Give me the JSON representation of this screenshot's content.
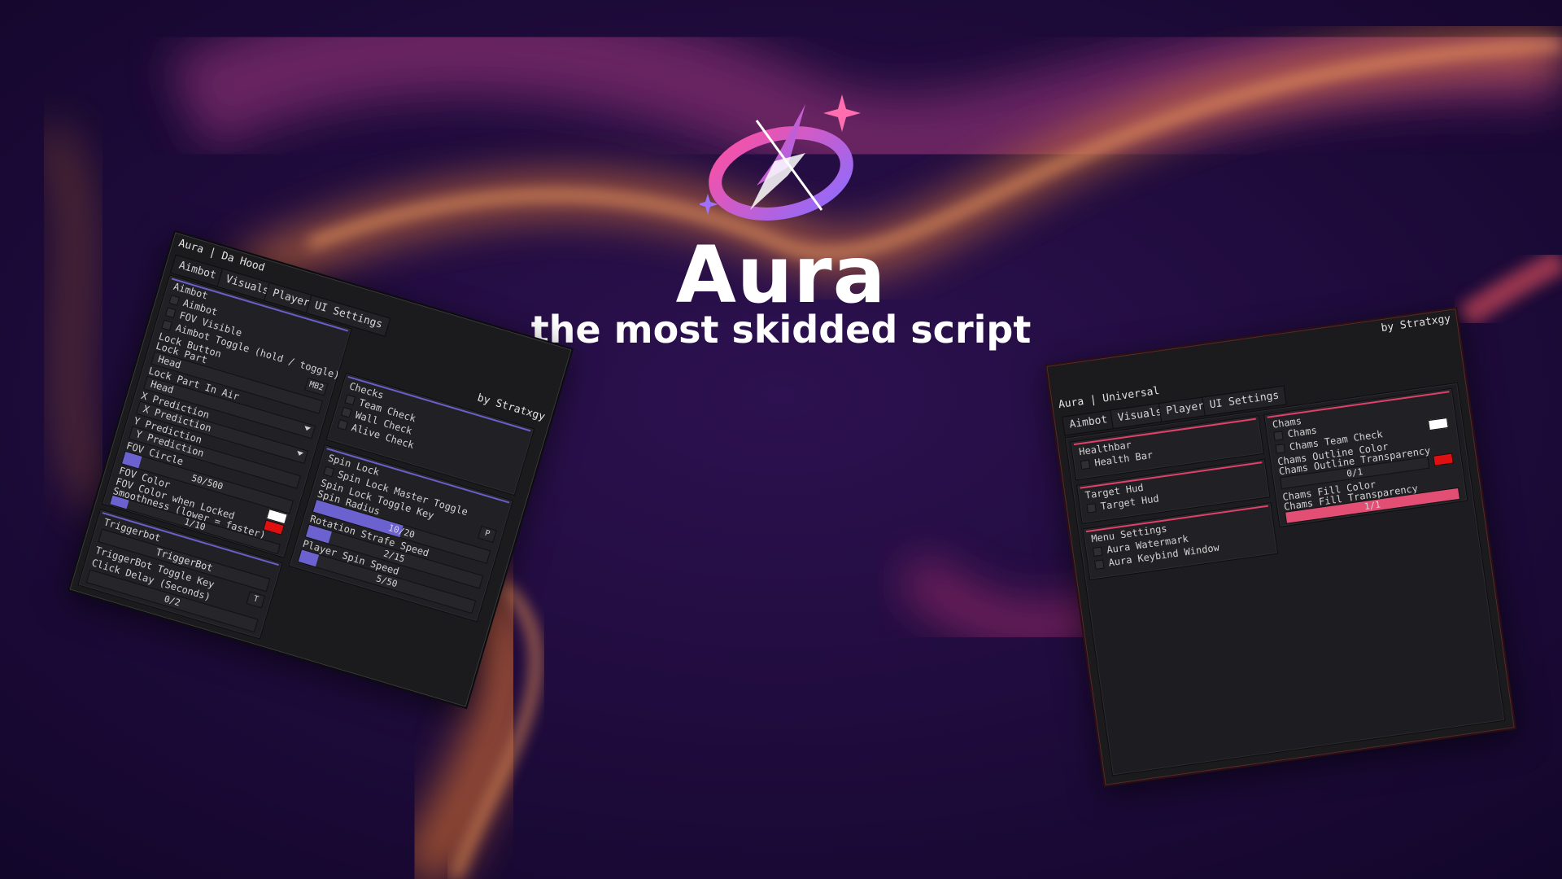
{
  "hero": {
    "title": "Aura",
    "subtitle": "the most skidded script",
    "logo": "aura-compass-orbit-logo"
  },
  "colors": {
    "bg_deep": "#180a35",
    "glow_orange": "#f08a3c",
    "glow_magenta": "#c83a7a",
    "accent_purple": "#6a5fc9",
    "accent_pink": "#e0406a",
    "swatch_white": "#ffffff",
    "swatch_red": "#e01010"
  },
  "left_window": {
    "title": "Aura | Da Hood",
    "author": "by Stratxgy",
    "tabs": [
      "Aimbot",
      "Visuals",
      "Player",
      "UI Settings"
    ],
    "aimbot_panel": {
      "header": "Aimbot",
      "aimbot": "Aimbot",
      "fov_visible": "FOV Visible",
      "aimbot_toggle": "Aimbot Toggle (hold / toggle)",
      "lock_button": "Lock Button",
      "lock_button_key": "MB2",
      "lock_part": "Lock Part",
      "lock_part_value": "Head",
      "lock_part_air": "Lock Part In Air",
      "lock_part_air_value": "Head",
      "x_prediction": "X Prediction",
      "x_prediction_field": "X Prediction",
      "y_prediction": "Y Prediction",
      "y_prediction_field": "Y Prediction",
      "fov_circle": "FOV Circle",
      "fov_circle_value": "50/500",
      "fov_color": "FOV Color",
      "fov_color_locked": "FOV Color when Locked",
      "smoothness": "Smoothness (lower = faster)",
      "smoothness_value": "1/10"
    },
    "triggerbot_panel": {
      "header": "Triggerbot",
      "triggerbot_button": "TriggerBot",
      "toggle_key": "TriggerBot Toggle Key",
      "toggle_key_value": "T",
      "click_delay": "Click Delay (Seconds)",
      "click_delay_value": "0/2"
    },
    "checks_panel": {
      "header": "Checks",
      "team_check": "Team Check",
      "wall_check": "Wall Check",
      "alive_check": "Alive Check"
    },
    "spinlock_panel": {
      "header": "Spin Lock",
      "master_toggle": "Spin Lock Master Toggle",
      "toggle_key": "Spin Lock Toggle Key",
      "toggle_key_value": "P",
      "spin_radius": "Spin Radius",
      "spin_radius_value": "10/20",
      "rotation_speed": "Rotation Strafe Speed",
      "rotation_speed_value": "2/15",
      "player_spin_speed": "Player Spin Speed",
      "player_spin_speed_value": "5/50"
    },
    "slider_levels": {
      "fov_circle": 0.1,
      "smoothness": 0.1,
      "click_delay": 0.0,
      "spin_radius": 0.5,
      "rotation_speed": 0.13,
      "player_spin_speed": 0.1
    }
  },
  "right_window": {
    "title": "Aura | Universal",
    "author": "by Stratxgy",
    "tabs": [
      "Aimbot",
      "Visuals",
      "Player",
      "UI Settings"
    ],
    "healthbar_panel": {
      "header": "Healthbar",
      "health_bar": "Health Bar"
    },
    "targethud_panel": {
      "header": "Target Hud",
      "target_hud": "Target Hud"
    },
    "menu_panel": {
      "header": "Menu Settings",
      "watermark": "Aura Watermark",
      "keybind_window": "Aura Keybind Window"
    },
    "chams_panel": {
      "header": "Chams",
      "chams": "Chams",
      "team_check": "Chams Team Check",
      "outline_color": "Chams Outline Color",
      "outline_transparency": "Chams Outline Transparency",
      "outline_transparency_value": "0/1",
      "fill_color": "Chams Fill Color",
      "fill_transparency": "Chams Fill Transparency",
      "fill_transparency_value": "1/1"
    },
    "slider_levels": {
      "outline_transparency": 0.0,
      "fill_transparency": 1.0
    }
  }
}
